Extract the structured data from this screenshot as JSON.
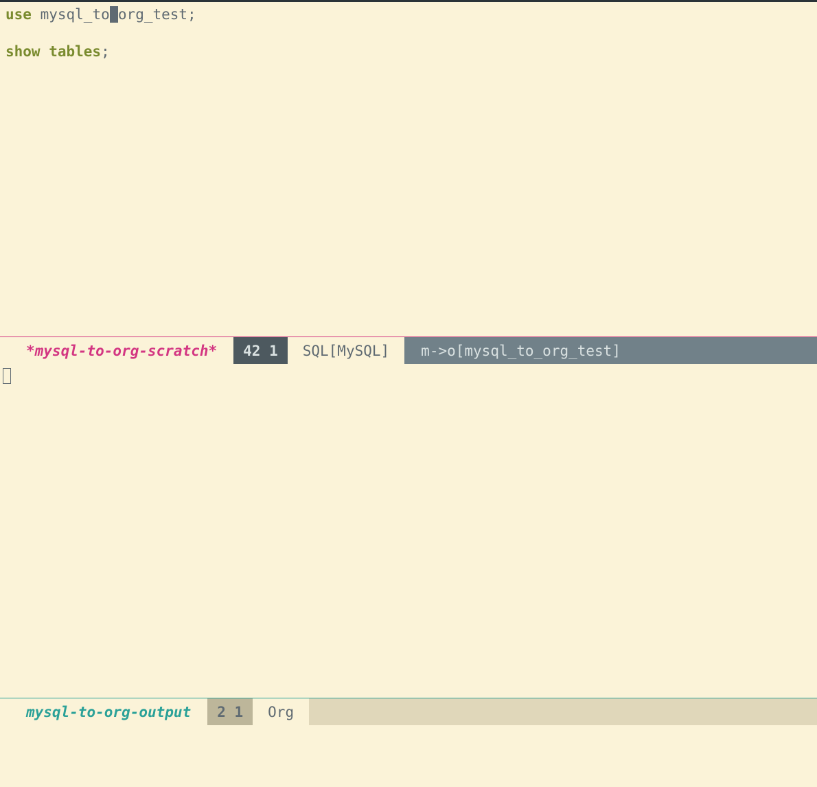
{
  "editor_top": {
    "line1": {
      "keyword": "use",
      "before_cursor": " mysql_to",
      "after_cursor": "org_test;"
    },
    "line3": {
      "keyword": "show",
      "keyword2": " tables",
      "rest": ";"
    }
  },
  "modeline_top": {
    "buffer_name": "*mysql-to-org-scratch*",
    "position": "42 1",
    "mode": "SQL[MySQL]",
    "extra": "m->o[mysql_to_org_test]"
  },
  "modeline_bottom": {
    "buffer_name": "mysql-to-org-output",
    "position": "2 1",
    "mode": "Org",
    "extra": ""
  }
}
